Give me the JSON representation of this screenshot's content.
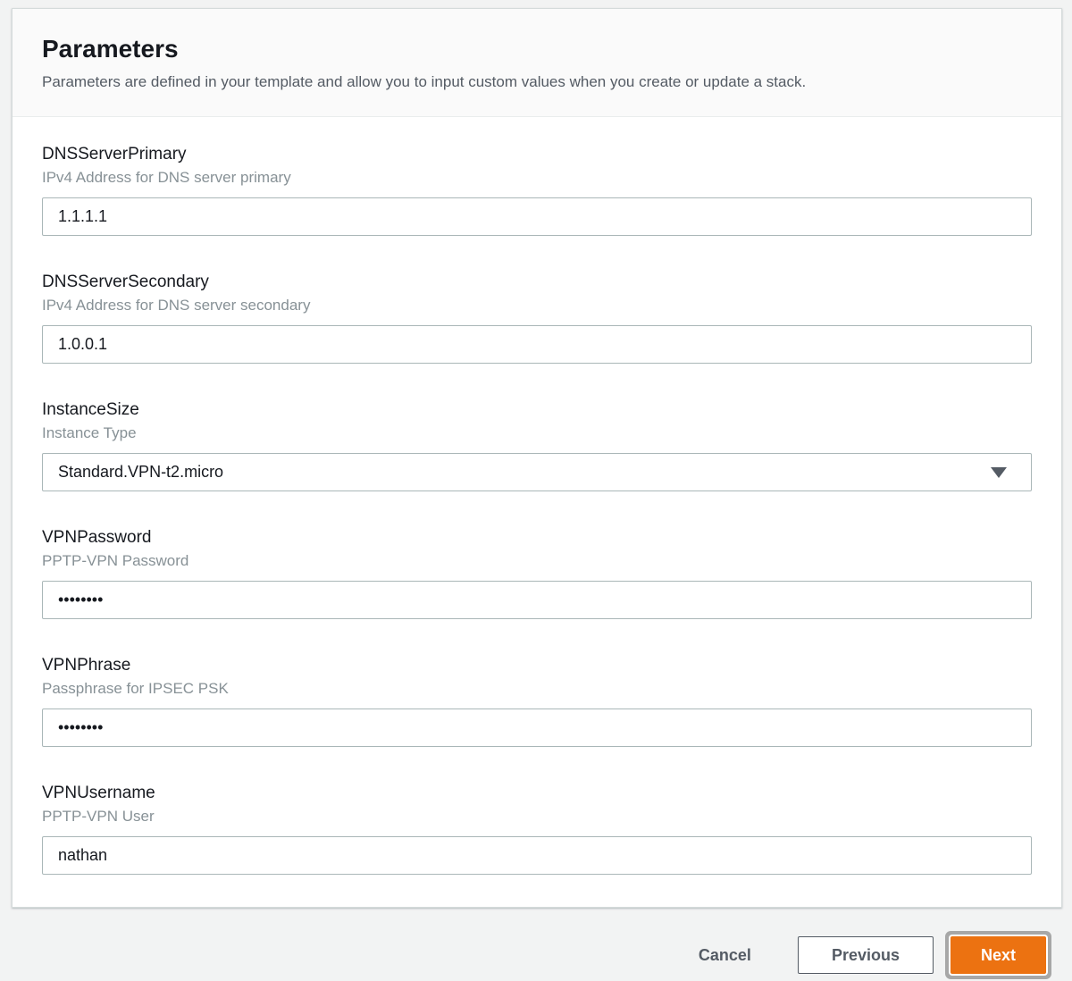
{
  "panel": {
    "title": "Parameters",
    "description": "Parameters are defined in your template and allow you to input custom values when you create or update a stack."
  },
  "fields": [
    {
      "label": "DNSServerPrimary",
      "description": "IPv4 Address for DNS server primary",
      "value": "1.1.1.1",
      "control": "text-input"
    },
    {
      "label": "DNSServerSecondary",
      "description": "IPv4 Address for DNS server secondary",
      "value": "1.0.0.1",
      "control": "text-input"
    },
    {
      "label": "InstanceSize",
      "description": "Instance Type",
      "value": "Standard.VPN-t2.micro",
      "control": "select",
      "icon": "caret-down-icon"
    },
    {
      "label": "VPNPassword",
      "description": "PPTP-VPN Password",
      "value": "••••••••",
      "control": "password-input"
    },
    {
      "label": "VPNPhrase",
      "description": "Passphrase for IPSEC PSK",
      "value": "••••••••",
      "control": "password-input"
    },
    {
      "label": "VPNUsername",
      "description": "PPTP-VPN User",
      "value": "nathan",
      "control": "text-input"
    }
  ],
  "actions": {
    "cancel_label": "Cancel",
    "previous_label": "Previous",
    "next_label": "Next",
    "focused_button": "Next"
  },
  "colors": {
    "primary_button": "#ec7211",
    "secondary_text": "#545b64",
    "field_description": "#879196",
    "input_border": "#aab7b8",
    "card_border": "#d5dbdb",
    "card_header_bg": "#fafafa",
    "page_bg": "#f2f3f3",
    "focus_ring": "#a7a7a7"
  }
}
